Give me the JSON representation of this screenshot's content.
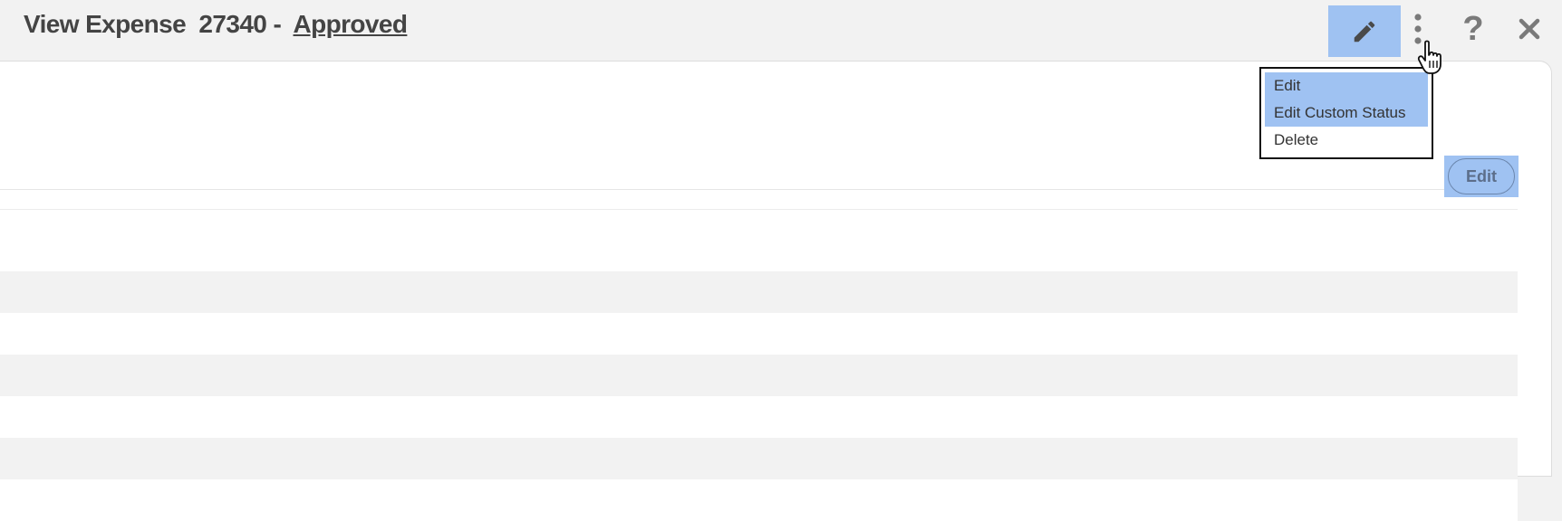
{
  "header": {
    "title_prefix": "View Expense  27340 -  ",
    "status": "Approved"
  },
  "toolbar": {
    "edit_icon": "pencil-icon",
    "more_icon": "kebab-icon",
    "help_label": "?",
    "close_icon": "close-icon"
  },
  "dropdown": {
    "items": [
      {
        "label": "Edit",
        "highlighted": true
      },
      {
        "label": "Edit Custom Status",
        "highlighted": true
      },
      {
        "label": "Delete",
        "highlighted": false
      }
    ]
  },
  "section": {
    "edit_button_label": "Edit"
  },
  "colors": {
    "highlight": "#9fc2f2",
    "background": "#f2f2f2",
    "text": "#444444"
  }
}
